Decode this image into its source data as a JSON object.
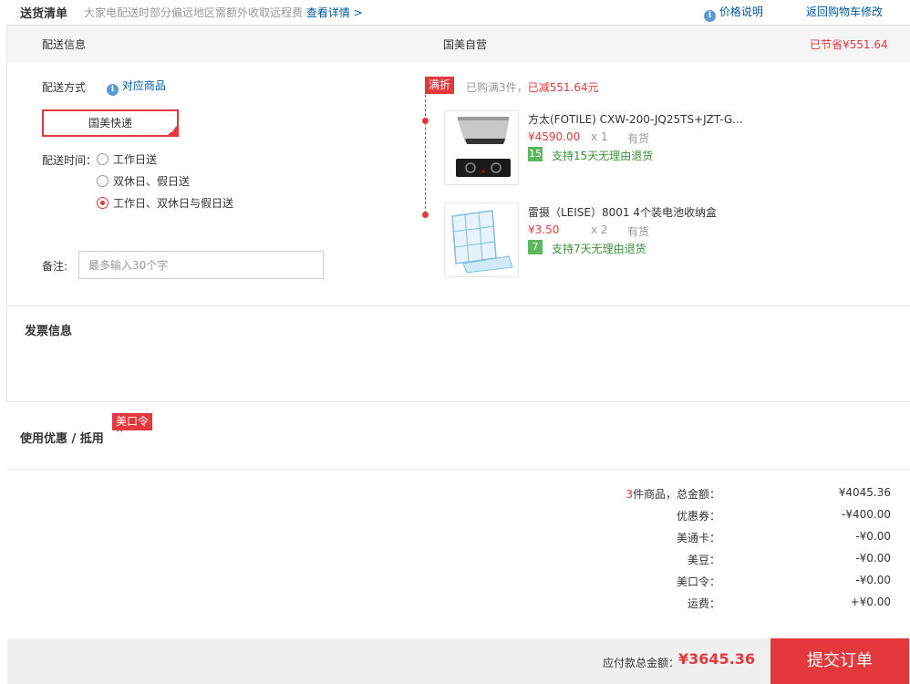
{
  "header": {
    "title": "送货清单",
    "notice": "大家电配送时部分偏远地区需额外收取远程费",
    "notice_link": "查看详情 >",
    "price_info": "价格说明",
    "return_cart": "返回购物车修改"
  },
  "section_bar": {
    "left": "配送信息",
    "middle": "国美自营",
    "saved": "已节省¥551.64"
  },
  "delivery": {
    "method_label": "配送方式",
    "method_link": "对应商品",
    "selected_method": "国美快递",
    "time_label": "配送时间：",
    "time_options": [
      {
        "label": "工作日送",
        "checked": false
      },
      {
        "label": "双休日、假日送",
        "checked": false
      },
      {
        "label": "工作日、双休日与假日送",
        "checked": true
      }
    ],
    "remark_label": "备注:",
    "remark_placeholder": "最多输入30个字"
  },
  "promo": {
    "tag": "满折",
    "text_grey": "已购满3件，",
    "text_red": "已减551.64元"
  },
  "items": [
    {
      "name": "方太(FOTILE) CXW-200-JQ25TS+JZT-G...",
      "price": "¥4590.00",
      "qty": "x 1",
      "stock": "有货",
      "return_days": "15",
      "return_text": "支持15天无理由退货"
    },
    {
      "name": "雷摄（LEISE）8001 4个装电池收纳盒",
      "price": "¥3.50",
      "qty": "x 2",
      "stock": "有货",
      "return_days": "7",
      "return_text": "支持7天无理由退货"
    }
  ],
  "invoice": {
    "title": "发票信息"
  },
  "coupon": {
    "title": "使用优惠 / 抵用",
    "caret": "^",
    "tag": "美口令"
  },
  "summary": {
    "items_count": "3",
    "items_label": "件商品，总金额：",
    "rows": [
      {
        "label": "优惠券：",
        "value": "-¥400.00"
      },
      {
        "label": "美通卡：",
        "value": "-¥0.00"
      },
      {
        "label": "美豆：",
        "value": "-¥0.00"
      },
      {
        "label": "美口令：",
        "value": "-¥0.00"
      },
      {
        "label": "运费：",
        "value": "+¥0.00"
      }
    ],
    "total_value": "¥4045.36"
  },
  "footer": {
    "pay_label": "应付款总金额：",
    "pay_amount": "¥3645.36",
    "submit_label": "提交订单"
  },
  "colors": {
    "accent": "#e4393c",
    "link": "#005aa0",
    "green": "#5cb85c"
  }
}
